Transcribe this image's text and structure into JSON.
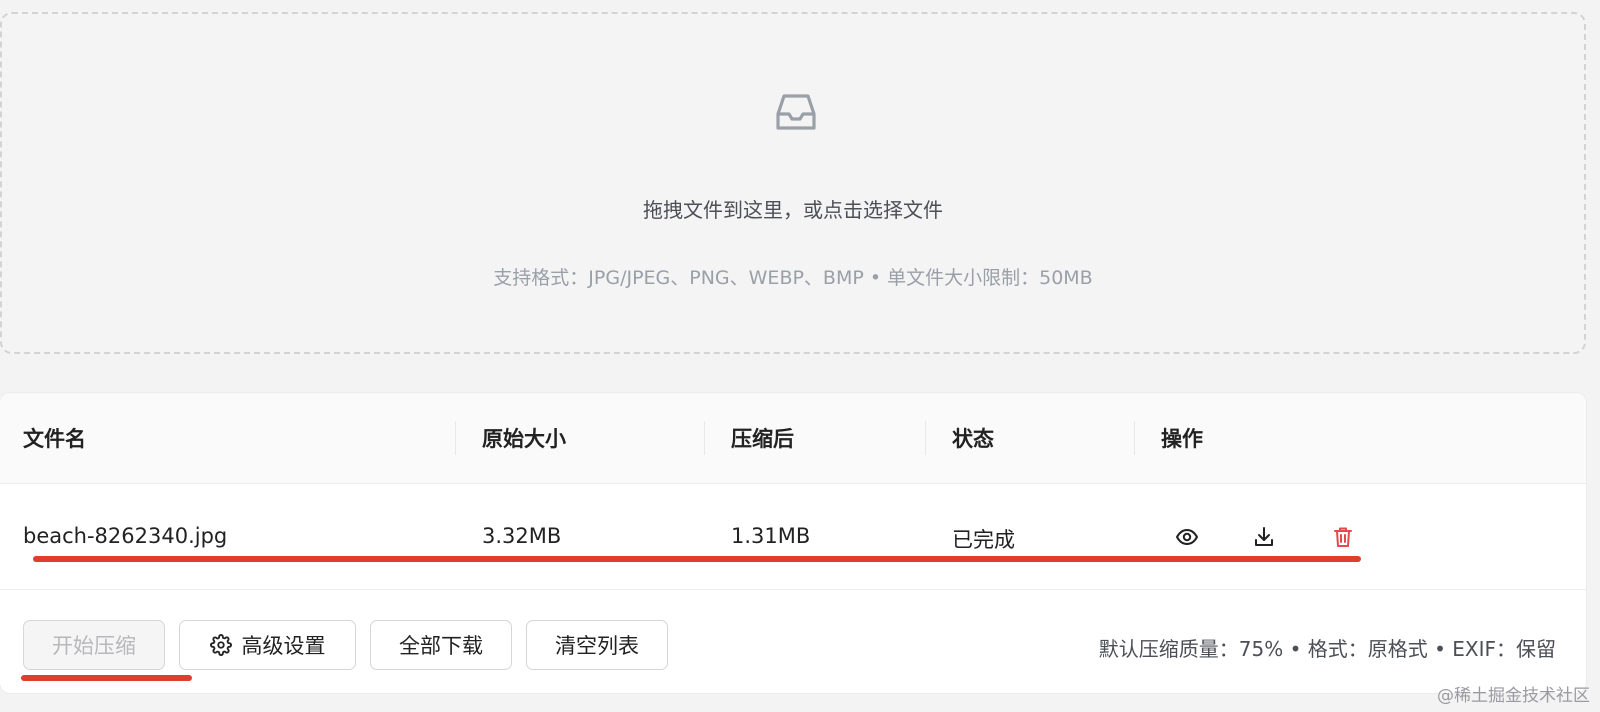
{
  "dropzone": {
    "main_text": "拖拽文件到这里，或点击选择文件",
    "hint_text": "支持格式：JPG/JPEG、PNG、WEBP、BMP • 单文件大小限制：50MB",
    "icon": "inbox-icon"
  },
  "table": {
    "columns": [
      "文件名",
      "原始大小",
      "压缩后",
      "状态",
      "操作"
    ],
    "rows": [
      {
        "filename": "beach-8262340.jpg",
        "original_size": "3.32MB",
        "compressed_size": "1.31MB",
        "status": "已完成",
        "actions": [
          "eye-icon",
          "download-icon",
          "trash-icon"
        ]
      }
    ]
  },
  "footer": {
    "start_button": "开始压缩",
    "advanced_button": "高级设置",
    "download_all_button": "全部下载",
    "clear_button": "清空列表",
    "info": "默认压缩质量：75% • 格式：原格式 • EXIF：保留"
  },
  "watermark": "@稀土掘金技术社区",
  "colors": {
    "accent_red": "#e03e2d",
    "delete_icon": "#e5484d",
    "border": "#d6d6d9",
    "background": "#f3f3f4"
  }
}
